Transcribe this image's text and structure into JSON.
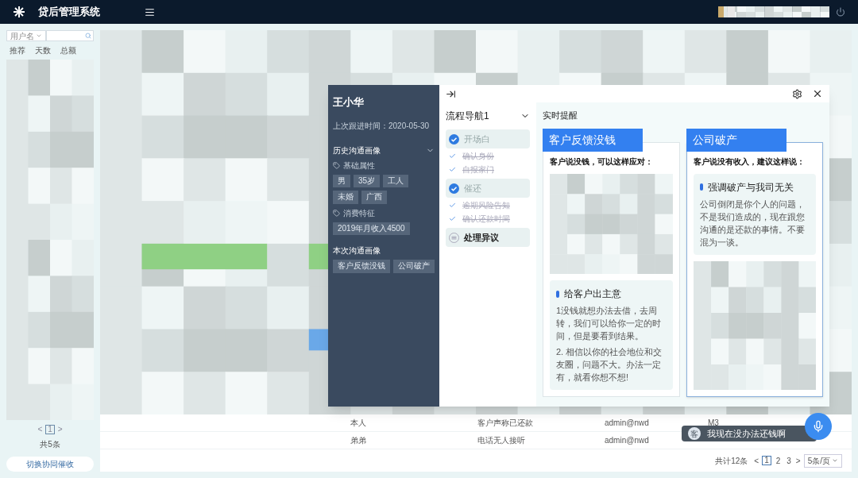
{
  "header": {
    "title": "贷后管理系统"
  },
  "sidebar": {
    "filter_field": "用户名",
    "columns": [
      "推荐",
      "天数",
      "总额"
    ],
    "pagination": {
      "prev": "<",
      "page": "1",
      "next": ">",
      "total": "共5条"
    },
    "switch_button": "切换协同催收"
  },
  "table": {
    "rows": [
      {
        "cells": [
          "本人",
          "客户声称已还款",
          "admin@nwd",
          "M3"
        ]
      },
      {
        "cells": [
          "弟弟",
          "电话无人接听",
          "admin@nwd"
        ]
      }
    ],
    "pagination": {
      "total": "共计12条",
      "prev": "<",
      "next": ">",
      "pages": [
        {
          "label": "1",
          "selected": true
        },
        {
          "label": "2",
          "selected": false
        },
        {
          "label": "3",
          "selected": false
        }
      ],
      "page_size": "5条/页"
    }
  },
  "customer": {
    "name": "王小华",
    "last_follow": "上次跟进时间：2020-05-30",
    "history_title": "历史沟通画像",
    "groups": [
      {
        "title": "基础属性",
        "tags": [
          "男",
          "35岁",
          "工人",
          "未婚",
          "广西"
        ]
      },
      {
        "title": "消费特征",
        "tags": [
          "2019年月收入4500"
        ]
      }
    ],
    "current_title": "本次沟通画像",
    "current_tags": [
      "客户反馈没钱",
      "公司破产"
    ]
  },
  "flow": {
    "title": "流程导航1",
    "steps": [
      {
        "label": "开场白",
        "kind": "done",
        "substeps": [
          {
            "label": "确认身份",
            "done": true
          },
          {
            "label": "自报家门",
            "done": true
          }
        ]
      },
      {
        "label": "催还",
        "kind": "done",
        "substeps": [
          {
            "label": "逾期风险告知",
            "done": true
          },
          {
            "label": "确认还款时间",
            "done": true
          }
        ]
      },
      {
        "label": "处理异议",
        "kind": "current"
      }
    ]
  },
  "reminders": {
    "title": "实时提醒",
    "cards": [
      {
        "tag": "客户反馈没钱",
        "intro": "客户说没钱，可以这样应对：",
        "selected": false,
        "blocks": [
          {
            "kind": "picture"
          },
          {
            "kind": "tip",
            "title": "给客户出主意",
            "paragraphs": [
              "1没钱就想办法去借，去周转，我们可以给你一定的时间，但是要看到结果。",
              "2. 相信以你的社会地位和交友圈，问题不大。办法一定有，就看你想不想!"
            ]
          }
        ]
      },
      {
        "tag": "公司破产",
        "intro": "客户说没有收入，建议这样说：",
        "selected": true,
        "blocks": [
          {
            "kind": "tip",
            "title": "强调破产与我司无关",
            "paragraphs": [
              "公司倒闭是你个人的问题，不是我们造成的，现在跟您沟通的是还款的事情。不要混为一谈。"
            ]
          },
          {
            "kind": "picture"
          }
        ]
      }
    ]
  },
  "toast": {
    "badge": "客",
    "message": "我现在没办法还钱啊"
  }
}
